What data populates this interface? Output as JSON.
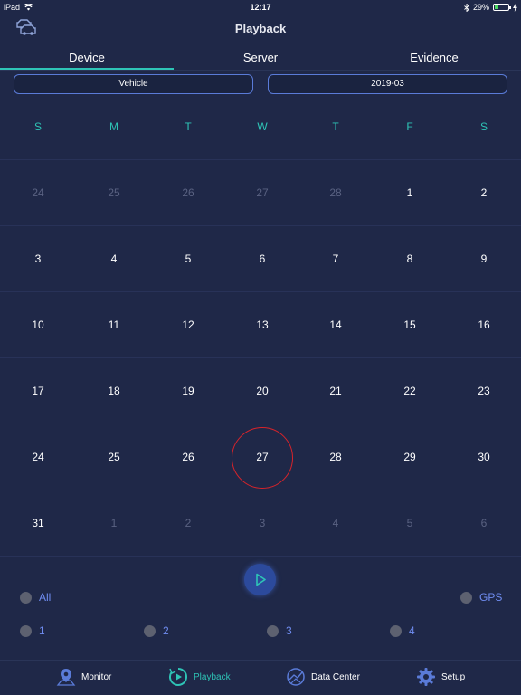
{
  "status_bar": {
    "device": "iPad",
    "time": "12:17",
    "battery": "29%",
    "battery_level": 0.29
  },
  "nav": {
    "title": "Playback"
  },
  "tabs": [
    {
      "label": "Device",
      "active": true
    },
    {
      "label": "Server",
      "active": false
    },
    {
      "label": "Evidence",
      "active": false
    }
  ],
  "selectors": {
    "vehicle": "Vehicle",
    "month": "2019-03"
  },
  "calendar": {
    "weekdays": [
      "S",
      "M",
      "T",
      "W",
      "T",
      "F",
      "S"
    ],
    "today": "27",
    "weeks": [
      [
        {
          "d": "24",
          "o": true
        },
        {
          "d": "25",
          "o": true
        },
        {
          "d": "26",
          "o": true
        },
        {
          "d": "27",
          "o": true
        },
        {
          "d": "28",
          "o": true
        },
        {
          "d": "1",
          "o": false
        },
        {
          "d": "2",
          "o": false
        }
      ],
      [
        {
          "d": "3",
          "o": false
        },
        {
          "d": "4",
          "o": false
        },
        {
          "d": "5",
          "o": false
        },
        {
          "d": "6",
          "o": false
        },
        {
          "d": "7",
          "o": false
        },
        {
          "d": "8",
          "o": false
        },
        {
          "d": "9",
          "o": false
        }
      ],
      [
        {
          "d": "10",
          "o": false
        },
        {
          "d": "11",
          "o": false
        },
        {
          "d": "12",
          "o": false
        },
        {
          "d": "13",
          "o": false
        },
        {
          "d": "14",
          "o": false
        },
        {
          "d": "15",
          "o": false
        },
        {
          "d": "16",
          "o": false
        }
      ],
      [
        {
          "d": "17",
          "o": false
        },
        {
          "d": "18",
          "o": false
        },
        {
          "d": "19",
          "o": false
        },
        {
          "d": "20",
          "o": false
        },
        {
          "d": "21",
          "o": false
        },
        {
          "d": "22",
          "o": false
        },
        {
          "d": "23",
          "o": false
        }
      ],
      [
        {
          "d": "24",
          "o": false
        },
        {
          "d": "25",
          "o": false
        },
        {
          "d": "26",
          "o": false
        },
        {
          "d": "27",
          "o": false,
          "today": true
        },
        {
          "d": "28",
          "o": false
        },
        {
          "d": "29",
          "o": false
        },
        {
          "d": "30",
          "o": false
        }
      ],
      [
        {
          "d": "31",
          "o": false
        },
        {
          "d": "1",
          "o": true
        },
        {
          "d": "2",
          "o": true
        },
        {
          "d": "3",
          "o": true
        },
        {
          "d": "4",
          "o": true
        },
        {
          "d": "5",
          "o": true
        },
        {
          "d": "6",
          "o": true
        }
      ]
    ]
  },
  "channels": {
    "all": "All",
    "gps": "GPS",
    "ch1": "1",
    "ch2": "2",
    "ch3": "3",
    "ch4": "4"
  },
  "tabbar": [
    {
      "label": "Monitor",
      "icon": "map-pin-icon",
      "active": false
    },
    {
      "label": "Playback",
      "icon": "playback-icon",
      "active": true
    },
    {
      "label": "Data Center",
      "icon": "data-center-icon",
      "active": false
    },
    {
      "label": "Setup",
      "icon": "gear-icon",
      "active": false
    }
  ],
  "colors": {
    "background": "#1f2848",
    "accent": "#2ec4b6",
    "link": "#6f8cf0",
    "today_ring": "#d8232a"
  }
}
